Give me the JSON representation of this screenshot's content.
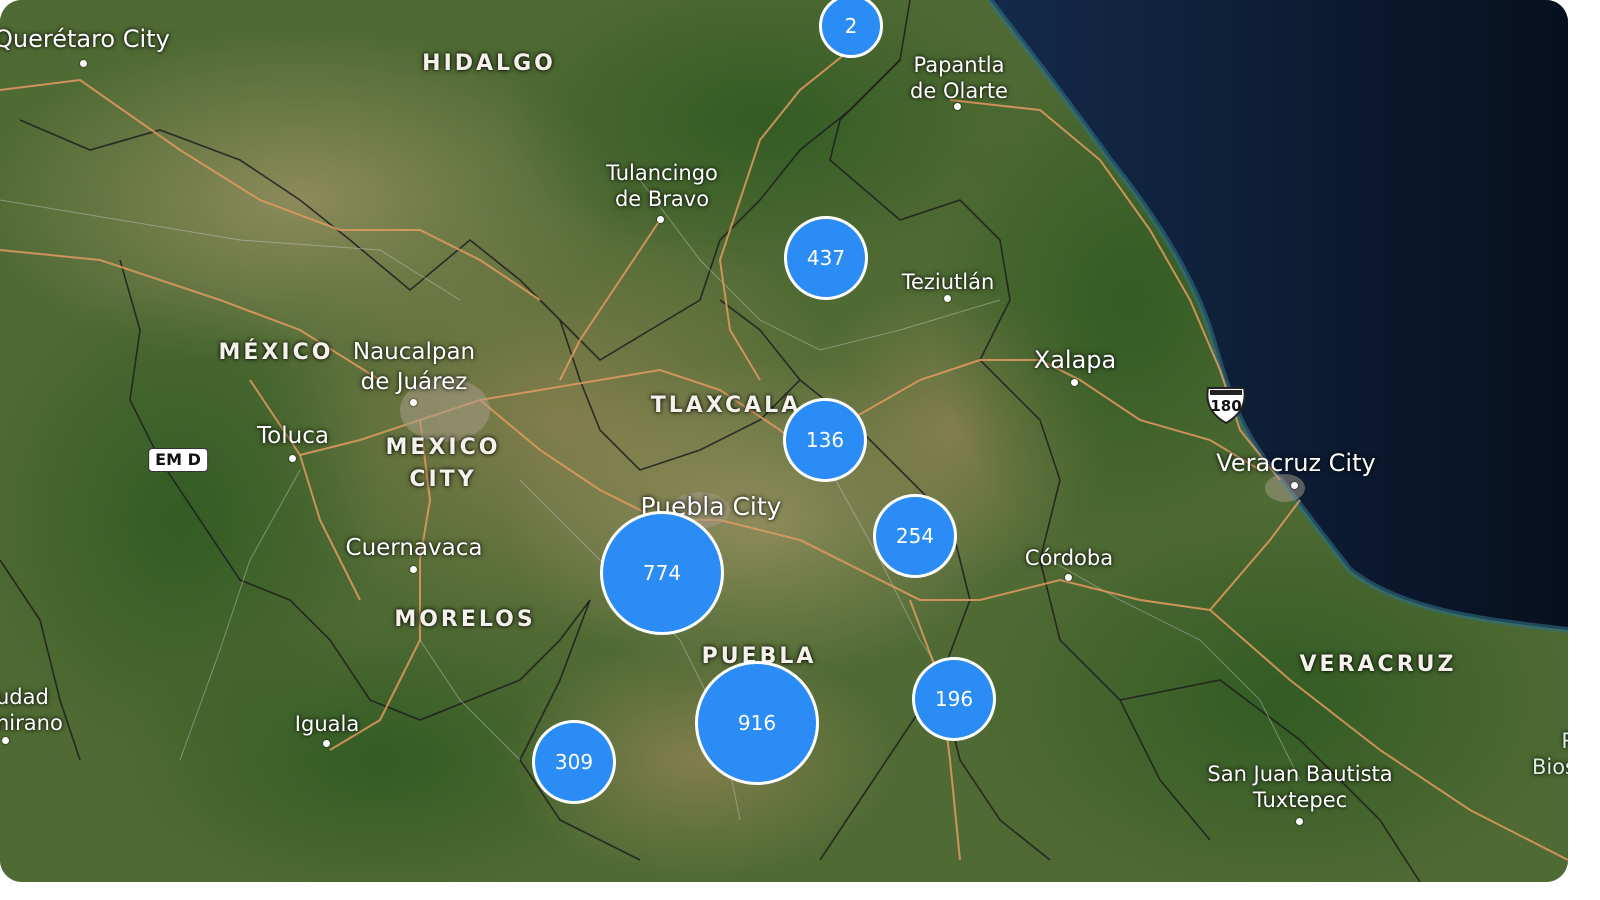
{
  "map": {
    "colors": {
      "ocean": "#0b1a33",
      "land": "#4f6a33",
      "roads": "#e39a62",
      "borders": "#1d1d1d",
      "cluster": "#2b8cf5"
    }
  },
  "states": [
    "HIDALGO",
    "MÉXICO",
    "TLAXCALA",
    "MEXICO\nCITY",
    "MORELOS",
    "PUEBLA",
    "VERACRUZ"
  ],
  "cities": [
    "Querétaro City",
    "Papantla\nde Olarte",
    "Tulancingo\nde Bravo",
    "Teziutlán",
    "Naucalpan\nde Juárez",
    "Xalapa",
    "Toluca",
    "Veracruz City",
    "Puebla City",
    "Cuernavaca",
    "Córdoba",
    "udad\nnirano",
    "Iguala",
    "San Juan Bautista\nTuxtepec",
    "R\nBios"
  ],
  "route_badges": [
    "EM D"
  ],
  "highway_shields": [
    "180"
  ],
  "clusters": [
    {
      "count": "2"
    },
    {
      "count": "437"
    },
    {
      "count": "136"
    },
    {
      "count": "254"
    },
    {
      "count": "774"
    },
    {
      "count": "916"
    },
    {
      "count": "196"
    },
    {
      "count": "309"
    }
  ]
}
